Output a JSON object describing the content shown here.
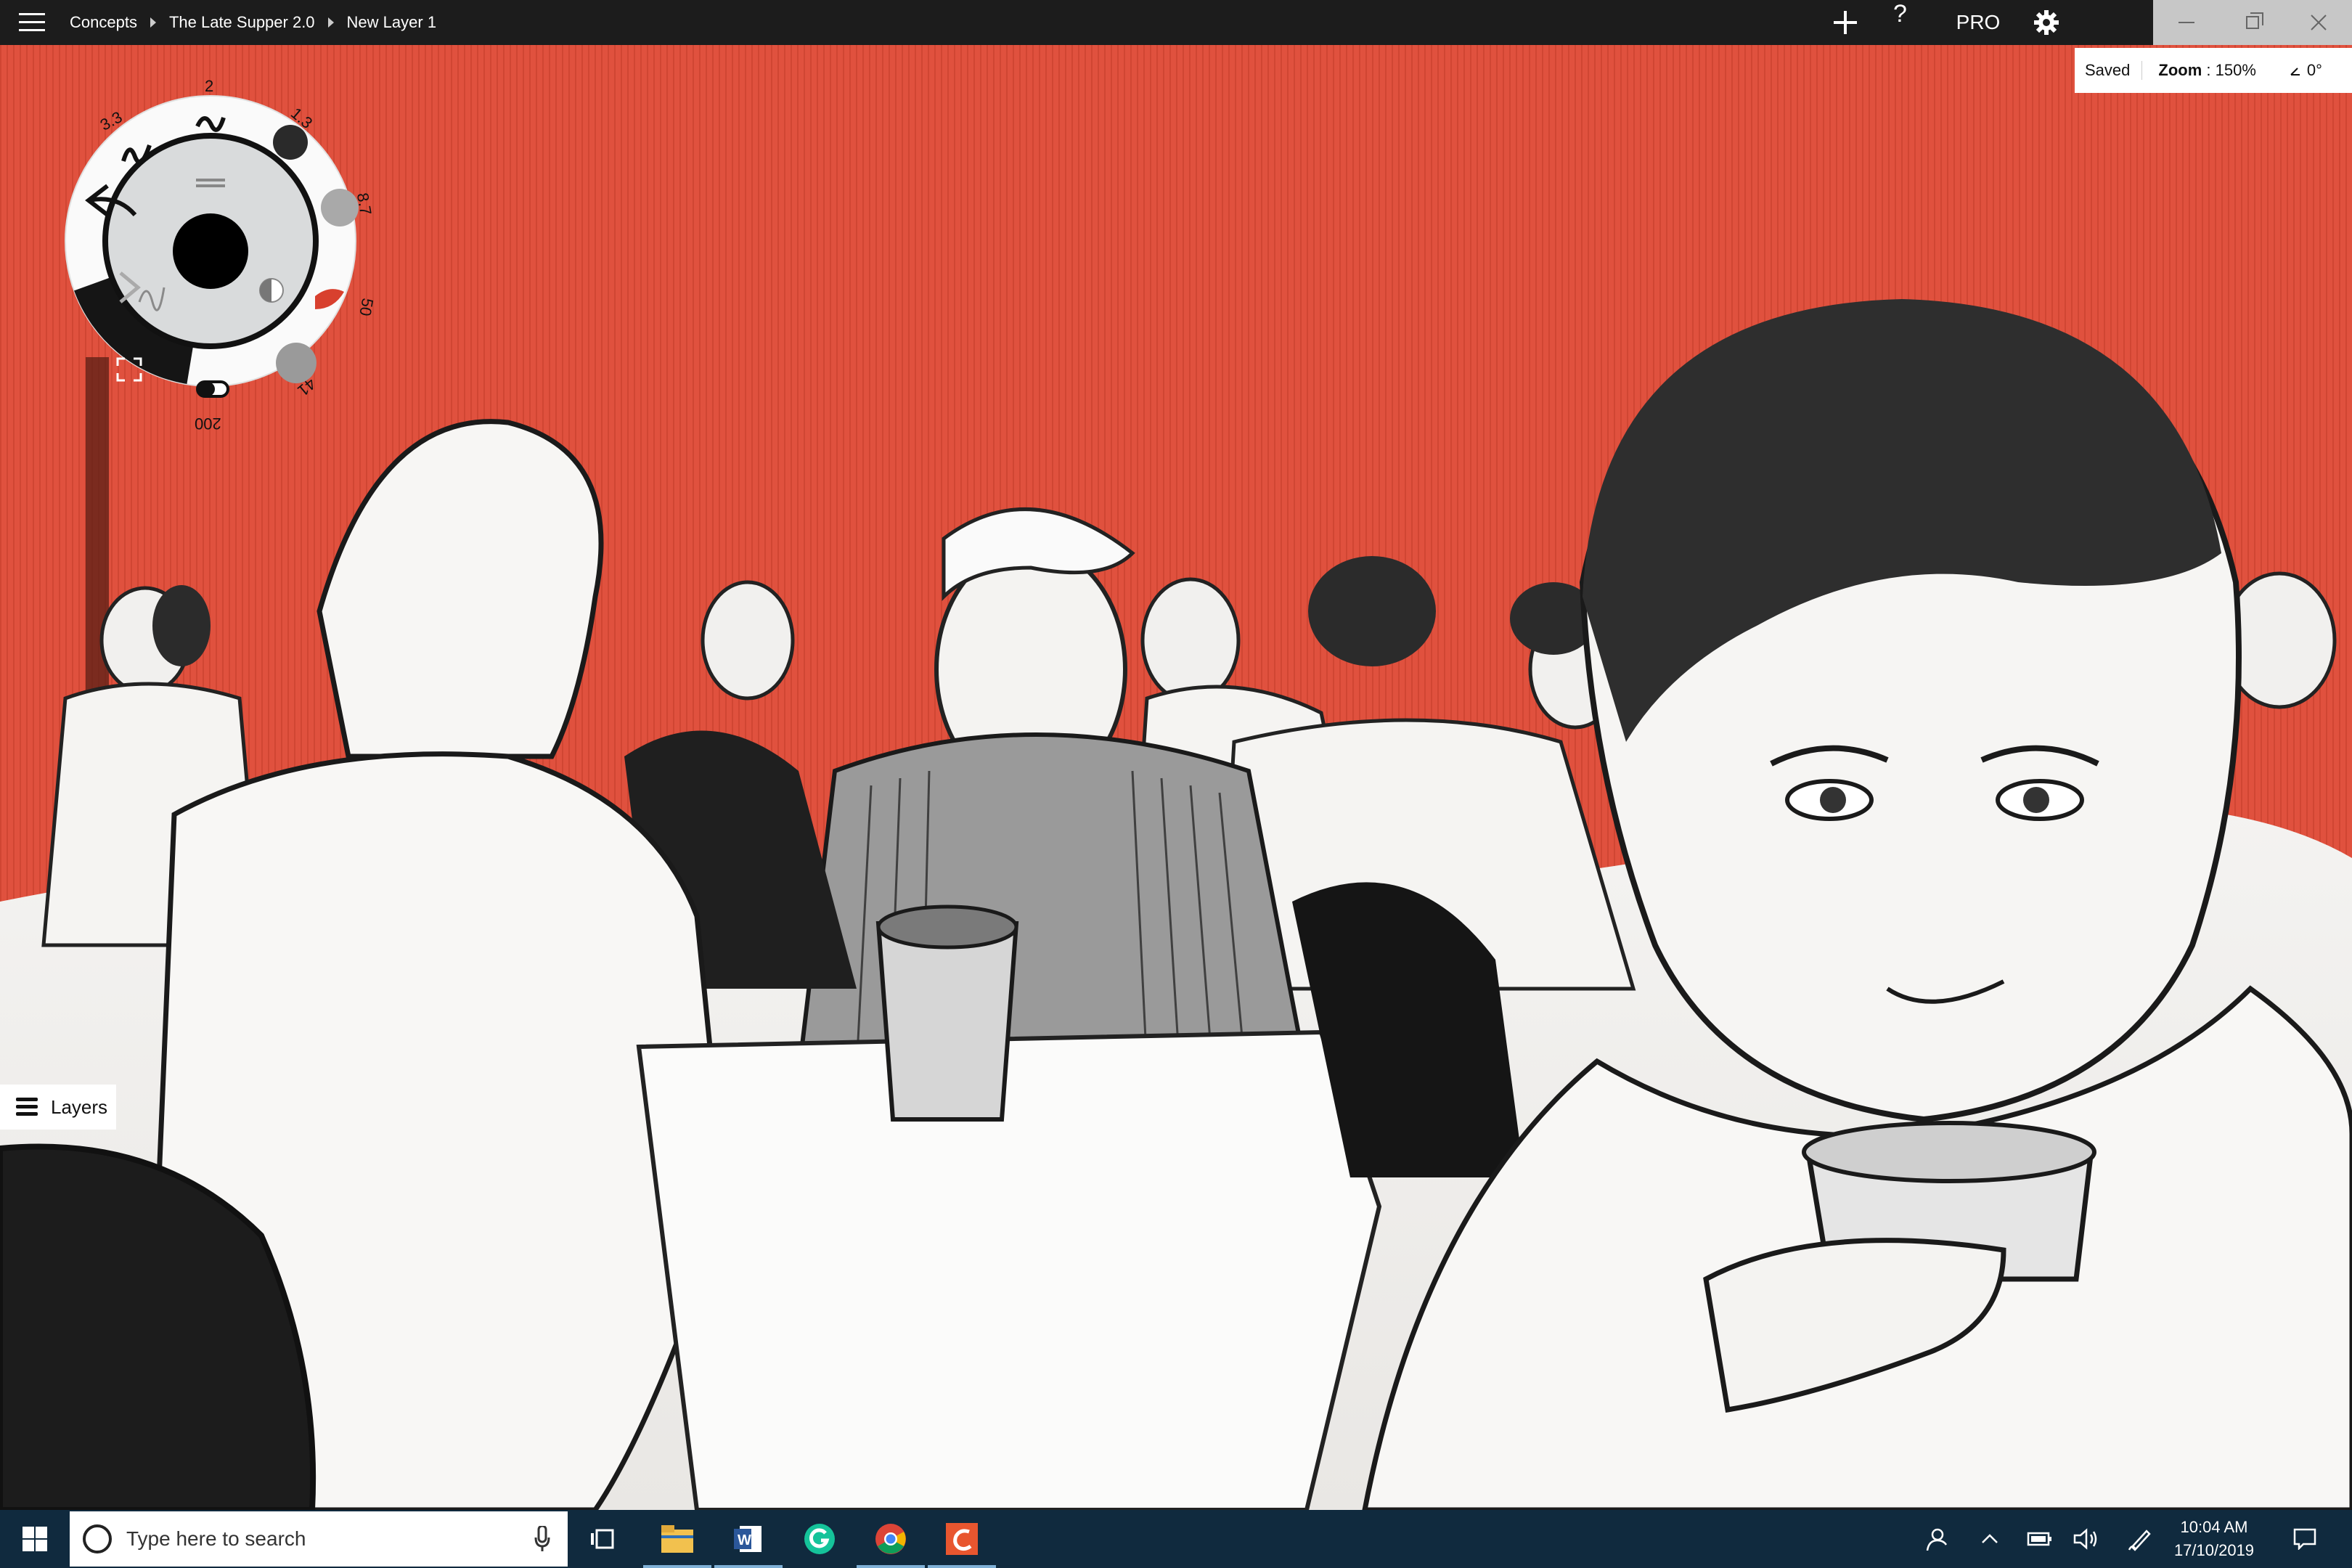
{
  "titlebar": {
    "breadcrumbs": [
      "Concepts",
      "The Late Supper 2.0",
      "New Layer 1"
    ],
    "help_label": "?",
    "pro_label": "PRO"
  },
  "status": {
    "saved": "Saved",
    "zoom_label": "Zoom",
    "zoom_value": "150%",
    "angle": "0°"
  },
  "tool_wheel": {
    "brush_sizes": [
      "3.3",
      "2",
      "1.3",
      "8.7",
      "50",
      "41",
      "200"
    ],
    "primary_color": "#000000",
    "accent_color": "#d8402e"
  },
  "layers": {
    "label": "Layers"
  },
  "taskbar": {
    "search_placeholder": "Type here to search",
    "time": "10:04 AM",
    "date": "17/10/2019"
  },
  "colors": {
    "background_red": "#e0513e",
    "titlebar": "#1c1c1c",
    "taskbar": "#102a3e"
  }
}
